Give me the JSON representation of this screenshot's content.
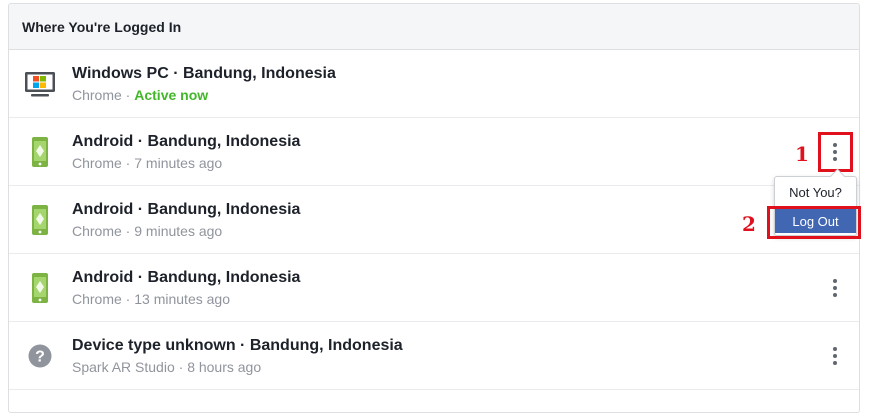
{
  "header": {
    "title": "Where You're Logged In"
  },
  "sessions": [
    {
      "title": "Windows PC · Bandung, Indonesia",
      "app": "Chrome",
      "sep": " · ",
      "time": "",
      "status": "Active now",
      "icon": "windows-pc-icon"
    },
    {
      "title": "Android · Bandung, Indonesia",
      "app": "Chrome",
      "sep": " · ",
      "time": "7 minutes ago",
      "icon": "android-phone-icon"
    },
    {
      "title": "Android · Bandung, Indonesia",
      "app": "Chrome",
      "sep": " · ",
      "time": "9 minutes ago",
      "icon": "android-phone-icon"
    },
    {
      "title": "Android · Bandung, Indonesia",
      "app": "Chrome",
      "sep": " · ",
      "time": "13 minutes ago",
      "icon": "android-phone-icon"
    },
    {
      "title": "Device type unknown · Bandung, Indonesia",
      "app": "Spark AR Studio",
      "sep": " · ",
      "time": "8 hours ago",
      "icon": "question-icon"
    }
  ],
  "menu": {
    "not_you": "Not You?",
    "log_out": "Log Out"
  },
  "annotations": {
    "step1": "1",
    "step2": "2"
  },
  "colors": {
    "active": "#42b72a",
    "highlight": "#e0101c",
    "logout_bg": "#4267b2",
    "android_green": "#8bc34a"
  }
}
